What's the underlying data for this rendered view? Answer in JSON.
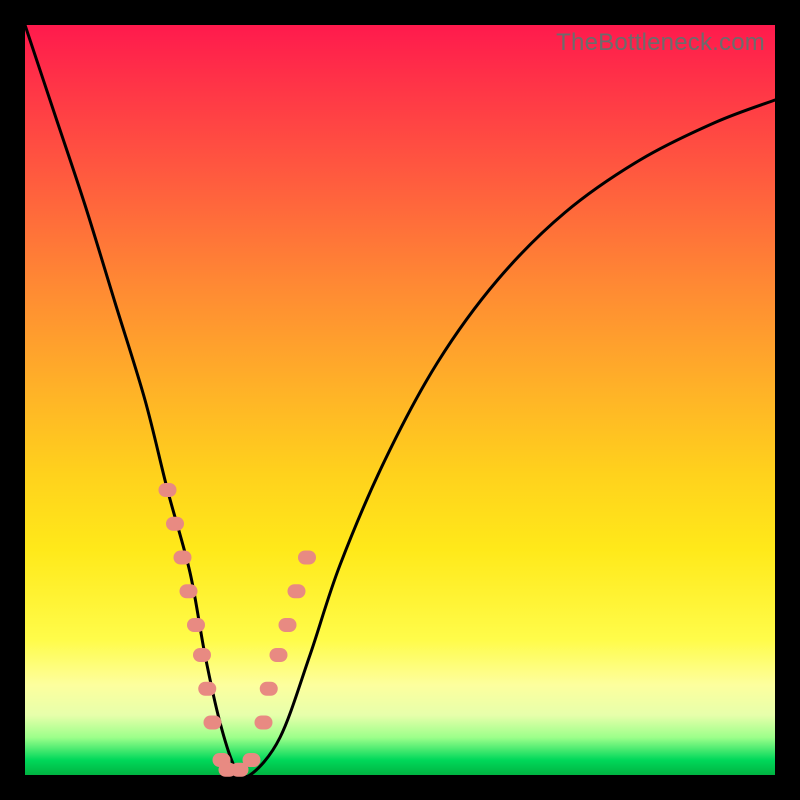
{
  "watermark": "TheBottleneck.com",
  "chart_data": {
    "type": "line",
    "title": "",
    "xlabel": "",
    "ylabel": "",
    "xlim": [
      0,
      100
    ],
    "ylim": [
      0,
      100
    ],
    "series": [
      {
        "name": "bottleneck-curve",
        "x": [
          0,
          4,
          8,
          12,
          16,
          19,
          22,
          24,
          26,
          28,
          30,
          34,
          38,
          42,
          48,
          55,
          63,
          72,
          82,
          92,
          100
        ],
        "values": [
          100,
          88,
          76,
          63,
          50,
          38,
          27,
          16,
          7,
          1,
          0,
          5,
          16,
          28,
          42,
          55,
          66,
          75,
          82,
          87,
          90
        ]
      }
    ],
    "markers": {
      "name": "highlight-dots",
      "x": [
        19.0,
        20.0,
        21.0,
        21.8,
        22.8,
        23.6,
        24.3,
        25.0,
        26.2,
        27.0,
        28.6,
        30.2,
        31.8,
        32.5,
        33.8,
        35.0,
        36.2,
        37.6
      ],
      "values": [
        38.0,
        33.5,
        29.0,
        24.5,
        20.0,
        16.0,
        11.5,
        7.0,
        2.0,
        0.7,
        0.7,
        2.0,
        7.0,
        11.5,
        16.0,
        20.0,
        24.5,
        29.0
      ]
    }
  }
}
